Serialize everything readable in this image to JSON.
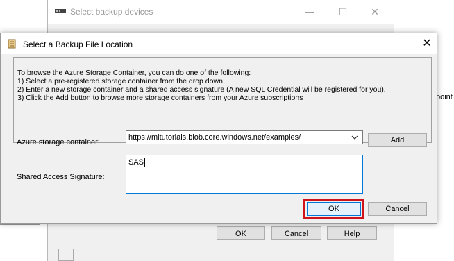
{
  "background_window": {
    "title": "Select backup devices",
    "minimize": "—",
    "maximize": "☐",
    "close": "✕",
    "buttons": {
      "ok": "OK",
      "cancel": "Cancel",
      "help": "Help"
    },
    "right_fragment": "point"
  },
  "dialog": {
    "title": "Select a Backup File Location",
    "close": "✕",
    "info_lines": [
      "To browse the Azure Storage Container, you can do one of the following:",
      "1) Select a pre-registered storage container from the drop down",
      "2) Enter a new storage container and a shared access signature (A new SQL Credential will be registered for you).",
      "3) Click the Add button to browse more storage containers from your Azure subscriptions"
    ],
    "container_label": "Azure storage container:",
    "container_value": "https://mitutorials.blob.core.windows.net/examples/",
    "add_button": "Add",
    "sas_label": "Shared Access Signature:",
    "sas_value": "SAS",
    "ok_button": "OK",
    "cancel_button": "Cancel"
  },
  "colors": {
    "highlight": "#d0121b",
    "focus": "#0078d7",
    "dialog_bg": "#f0f0f0"
  }
}
